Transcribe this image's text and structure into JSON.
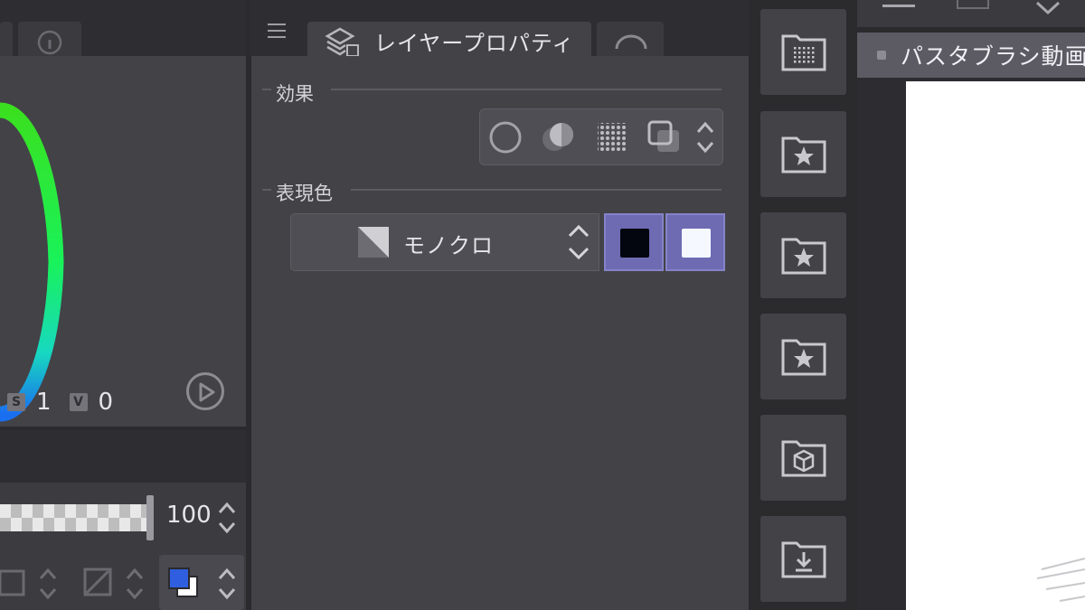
{
  "color_panel": {
    "hsv": [
      {
        "badge": "S",
        "value": "1"
      },
      {
        "badge": "V",
        "value": "0"
      }
    ]
  },
  "layer_panel": {
    "opacity_value": "100"
  },
  "properties_panel": {
    "tab_title": "レイヤープロパティ",
    "effect_label": "効果",
    "expression_color_label": "表現色",
    "expression_color_value": "モノクロ",
    "swatch_colors": [
      "#03050f",
      "#f5f8ff"
    ]
  },
  "canvas": {
    "tab_title": "パスタブラシ動画"
  },
  "dock": {
    "icons": [
      "screentone-folder-icon",
      "star-folder-icon",
      "star-folder-icon",
      "star-folder-icon",
      "3d-folder-icon",
      "download-folder-icon"
    ]
  }
}
